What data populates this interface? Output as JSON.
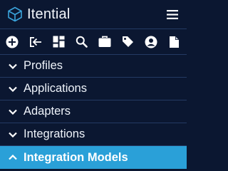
{
  "brand": {
    "name": "Itential",
    "logo_icon": "itential-cube-logo-icon"
  },
  "header": {
    "menu_icon": "hamburger-menu-icon"
  },
  "toolbar": {
    "icons": [
      "add-circle-icon",
      "sign-out-icon",
      "dashboard-grid-icon",
      "search-icon",
      "briefcase-icon",
      "tag-icon",
      "user-circle-icon",
      "file-icon"
    ]
  },
  "nav": {
    "items": [
      {
        "label": "Profiles",
        "state": "collapsed"
      },
      {
        "label": "Applications",
        "state": "collapsed"
      },
      {
        "label": "Adapters",
        "state": "collapsed"
      },
      {
        "label": "Integrations",
        "state": "collapsed"
      },
      {
        "label": "Integration Models",
        "state": "expanded"
      }
    ]
  },
  "colors": {
    "background": "#0b1731",
    "divider": "#243a63",
    "active": "#2aa0d8",
    "logo": "#3aa3db",
    "text": "#ffffff"
  }
}
